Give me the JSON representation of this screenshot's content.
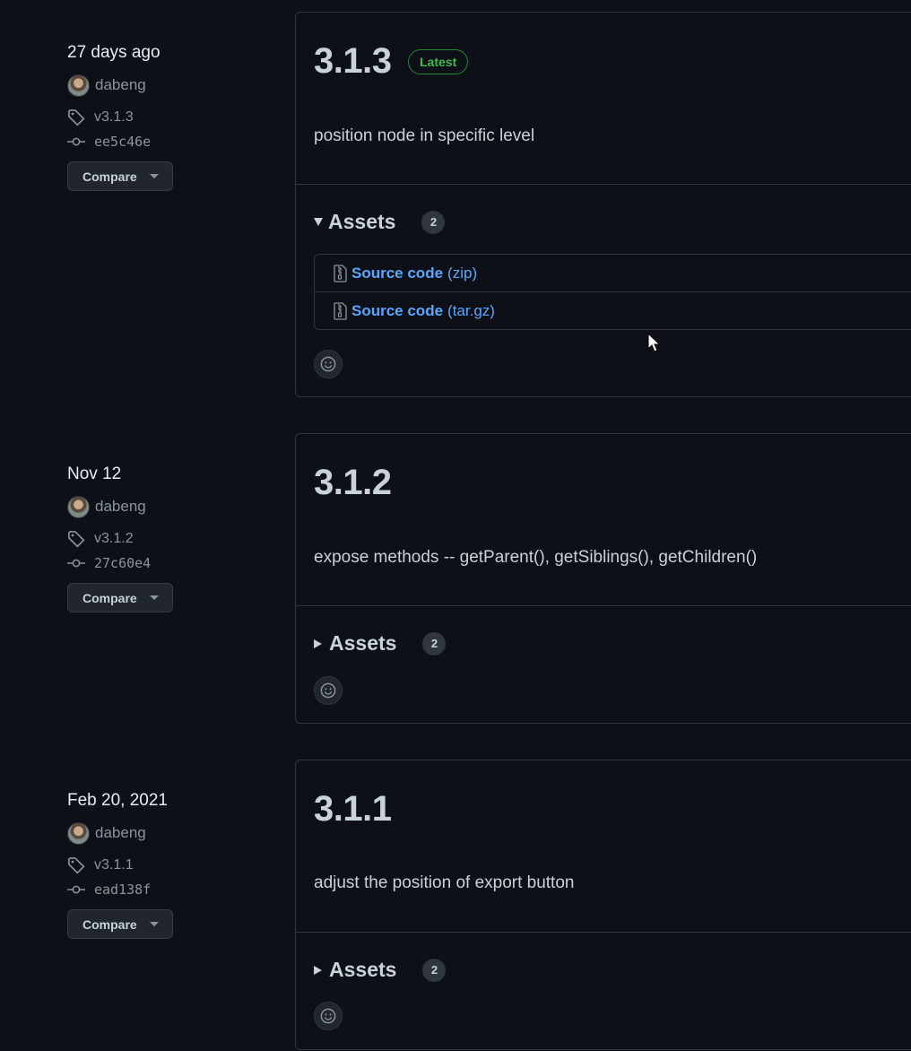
{
  "releases": [
    {
      "date": "27 days ago",
      "author": "dabeng",
      "tag": "v3.1.3",
      "commit": "ee5c46e",
      "compare_label": "Compare",
      "version": "3.1.3",
      "latest_label": "Latest",
      "description": "position node in specific level",
      "assets_label": "Assets",
      "assets_count": "2",
      "assets_expanded": true,
      "assets": [
        {
          "name": "Source code",
          "ext": "(zip)"
        },
        {
          "name": "Source code",
          "ext": "(tar.gz)"
        }
      ]
    },
    {
      "date": "Nov 12",
      "author": "dabeng",
      "tag": "v3.1.2",
      "commit": "27c60e4",
      "compare_label": "Compare",
      "version": "3.1.2",
      "description": "expose methods -- getParent(), getSiblings(), getChildren()",
      "assets_label": "Assets",
      "assets_count": "2",
      "assets_expanded": false
    },
    {
      "date": "Feb 20, 2021",
      "author": "dabeng",
      "tag": "v3.1.1",
      "commit": "ead138f",
      "compare_label": "Compare",
      "version": "3.1.1",
      "description": "adjust the position of export button",
      "assets_label": "Assets",
      "assets_count": "2",
      "assets_expanded": false
    }
  ],
  "icons": {
    "tag": "tag-icon",
    "commit": "git-commit-icon",
    "zip": "file-zip-icon",
    "emoji": "smiley-icon"
  },
  "colors": {
    "background": "#0d1117",
    "border": "#30363d",
    "link": "#58a6ff",
    "latest": "#3fb950"
  }
}
